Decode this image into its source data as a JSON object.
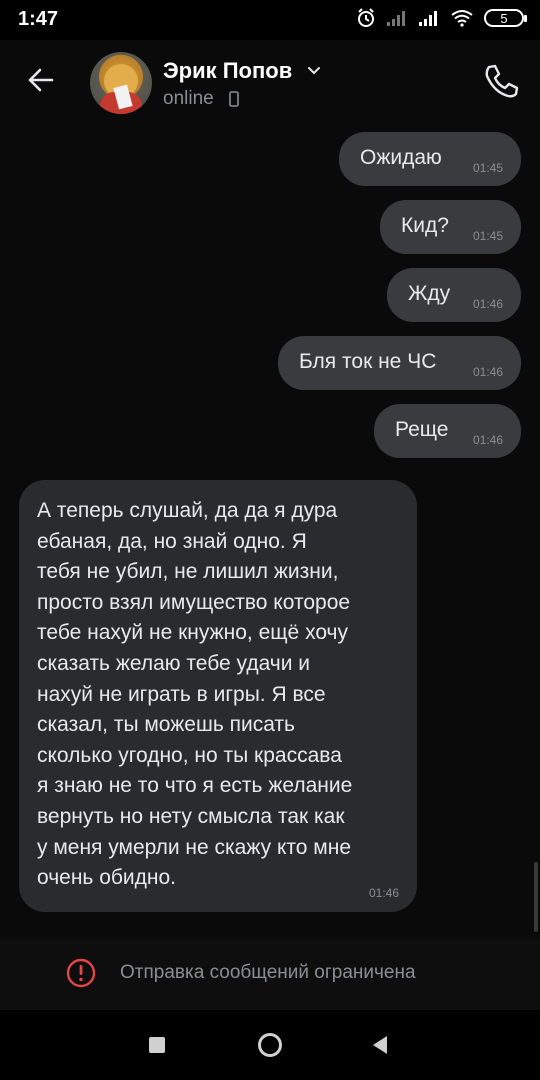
{
  "status_bar": {
    "time": "1:47",
    "battery_level": "5"
  },
  "header": {
    "contact_name": "Эрик Попов",
    "status": "online"
  },
  "messages_out": [
    {
      "text": "Ожидаю",
      "time": "01:45"
    },
    {
      "text": "Кид?",
      "time": "01:45"
    },
    {
      "text": "Жду",
      "time": "01:46"
    },
    {
      "text": "Бля ток не ЧС",
      "time": "01:46"
    },
    {
      "text": "Реще",
      "time": "01:46"
    }
  ],
  "message_in": {
    "text": "А теперь слушай, да да я дура\nебаная, да, но знай одно. Я\nтебя не убил, не лишил жизни,\nпросто взял имущество которое\nтебе нахуй не кнужно, ещё хочу\nсказать желаю тебе удачи и\nнахуй не играть в игры. Я все\nсказал, ты можешь писать\nсколько угодно, но ты крассава\nя знаю не то что я есть желание\nвернуть но нету смысла так как\nу меня умерли не скажу кто мне\nочень обидно.",
    "time": "01:46"
  },
  "restriction": {
    "text": "Отправка сообщений ограничена"
  },
  "colors": {
    "background": "#0a0a0a",
    "outgoing_bubble": "#3a3b3e",
    "incoming_bubble": "#2a2b2d",
    "warning_red": "#e64646"
  }
}
